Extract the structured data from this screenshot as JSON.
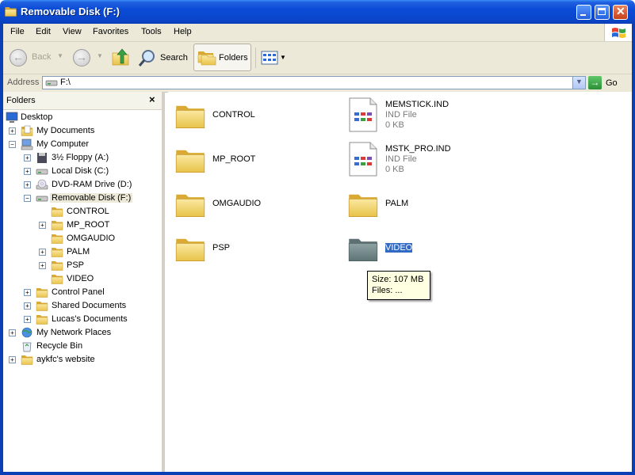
{
  "window": {
    "title": "Removable Disk (F:)"
  },
  "menu": {
    "file": "File",
    "edit": "Edit",
    "view": "View",
    "favorites": "Favorites",
    "tools": "Tools",
    "help": "Help"
  },
  "toolbar": {
    "back": "Back",
    "search": "Search",
    "folders": "Folders"
  },
  "address": {
    "label": "Address",
    "value": "F:\\",
    "go": "Go"
  },
  "folders_pane": {
    "title": "Folders",
    "close": "×",
    "tree": [
      {
        "label": "Desktop"
      },
      {
        "label": "My Documents"
      },
      {
        "label": "My Computer"
      },
      {
        "label": "3½ Floppy (A:)"
      },
      {
        "label": "Local Disk (C:)"
      },
      {
        "label": "DVD-RAM Drive (D:)"
      },
      {
        "label": "Removable Disk (F:)"
      },
      {
        "label": "CONTROL"
      },
      {
        "label": "MP_ROOT"
      },
      {
        "label": "OMGAUDIO"
      },
      {
        "label": "PALM"
      },
      {
        "label": "PSP"
      },
      {
        "label": "VIDEO"
      },
      {
        "label": "Control Panel"
      },
      {
        "label": "Shared Documents"
      },
      {
        "label": "Lucas's Documents"
      },
      {
        "label": "My Network Places"
      },
      {
        "label": "Recycle Bin"
      },
      {
        "label": "aykfc's website"
      }
    ]
  },
  "files": [
    {
      "name": "CONTROL"
    },
    {
      "name": "MP_ROOT"
    },
    {
      "name": "OMGAUDIO"
    },
    {
      "name": "PSP"
    },
    {
      "name": "MEMSTICK.IND",
      "type": "IND File",
      "size": "0 KB"
    },
    {
      "name": "MSTK_PRO.IND",
      "type": "IND File",
      "size": "0 KB"
    },
    {
      "name": "PALM"
    },
    {
      "name": "VIDEO"
    }
  ],
  "tooltip": {
    "size": "Size: 107 MB",
    "files": "Files: ..."
  },
  "colors": {
    "titlebar": "#0a46cc",
    "selection": "#316ac5",
    "folder": "#f3d46a"
  },
  "icons": [
    "folder-icon",
    "ind-file-icon",
    "desktop-icon",
    "my-documents-icon",
    "my-computer-icon",
    "floppy-drive-icon",
    "local-disk-icon",
    "dvd-drive-icon",
    "removable-disk-icon",
    "control-panel-icon",
    "network-places-icon",
    "recycle-bin-icon",
    "windows-logo-icon",
    "back-arrow-icon",
    "forward-arrow-icon",
    "up-folder-icon",
    "search-magnifier-icon",
    "views-icon",
    "go-arrow-icon"
  ]
}
